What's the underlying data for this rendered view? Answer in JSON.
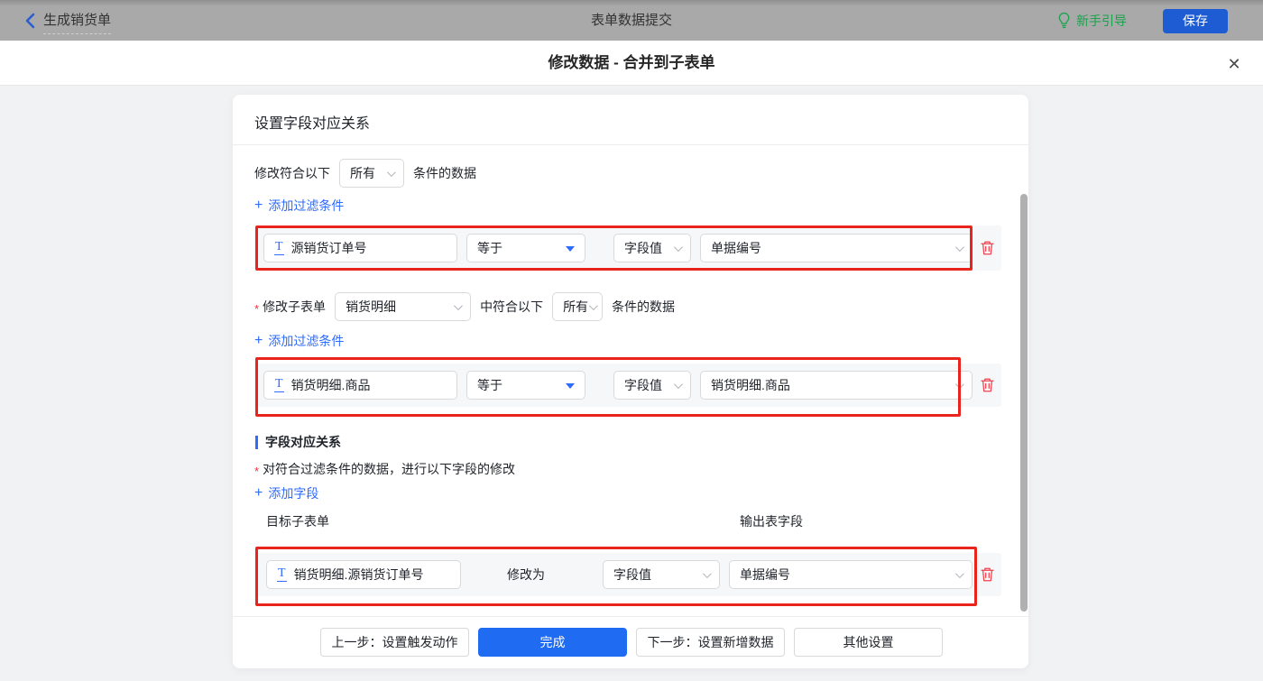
{
  "topbar": {
    "back": "生成销货单",
    "title": "表单数据提交",
    "guide": "新手引导",
    "save": "保存"
  },
  "dialog": {
    "title": "修改数据 - 合并到子表单",
    "close_glyph": "✕"
  },
  "panel": {
    "header": "设置字段对应关系",
    "plus": "+",
    "asterisk": "*",
    "text_icon_glyph": "T",
    "filter_main": {
      "prefix": "修改符合以下",
      "match": "所有",
      "suffix": "条件的数据",
      "add": "添加过滤条件",
      "row": {
        "field": "源销货订单号",
        "op": "等于",
        "value_type": "字段值",
        "value": "单据编号"
      }
    },
    "filter_sub": {
      "label": "修改子表单",
      "subform": "销货明细",
      "mid": "中符合以下",
      "match": "所有",
      "suffix": "条件的数据",
      "add": "添加过滤条件",
      "row": {
        "field": "销货明细.商品",
        "op": "等于",
        "value_type": "字段值",
        "value": "销货明细.商品"
      }
    },
    "mapping": {
      "title": "字段对应关系",
      "desc": "对符合过滤条件的数据，进行以下字段的修改",
      "add": "添加字段",
      "col_target": "目标子表单",
      "col_output": "输出表字段",
      "row": {
        "field": "销货明细.源销货订单号",
        "middle": "修改为",
        "value_type": "字段值",
        "value": "单据编号"
      }
    },
    "footer": {
      "prev": "上一步：设置触发动作",
      "done": "完成",
      "next": "下一步：设置新增数据",
      "other": "其他设置"
    }
  },
  "colors": {
    "topbar_bg": "#a9a9a9",
    "accent_blue": "#2e6bff",
    "primary_button": "#1f6bf2",
    "save_button": "#1d5cd3",
    "highlight_border_red": "#e8241d",
    "delete_icon_red": "#f0414e",
    "guide_green": "#19a34c",
    "panel_bg": "#ffffff",
    "page_bg": "#f1f2f4"
  }
}
